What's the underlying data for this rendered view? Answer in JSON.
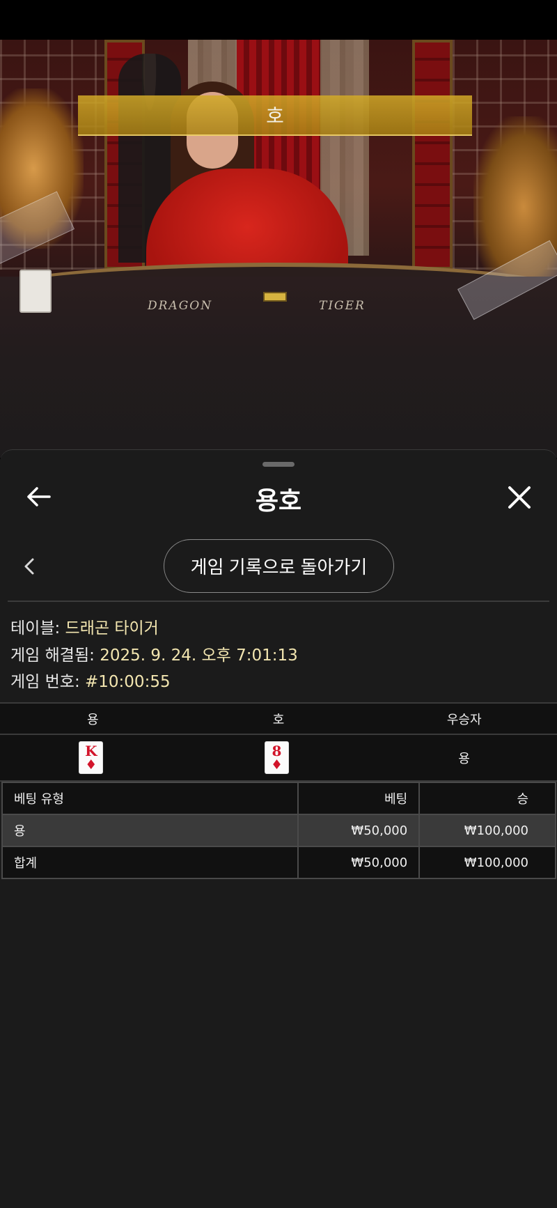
{
  "video": {
    "result_banner": "호",
    "table_labels": {
      "dragon": "DRAGON",
      "tiger": "TIGER"
    }
  },
  "sheet": {
    "title": "용호",
    "back_icon": "arrow-left-icon",
    "close_icon": "close-icon",
    "prev_icon": "chevron-left-icon",
    "return_button": "게임 기록으로 돌아가기"
  },
  "info": {
    "table_label": "테이블:",
    "table_value": "드래곤 타이거",
    "resolved_label": "게임 해결됨:",
    "resolved_value": "2025. 9. 24. 오후 7:01:13",
    "game_no_label": "게임 번호:",
    "game_no_value": "#10:00:55"
  },
  "cards": {
    "headers": [
      "용",
      "호",
      "우승자"
    ],
    "dragon_card": {
      "rank": "K",
      "suit": "♦"
    },
    "tiger_card": {
      "rank": "8",
      "suit": "♦"
    },
    "winner": "용",
    "card_color": "#d2142a"
  },
  "bets": {
    "headers": [
      "베팅 유형",
      "베팅",
      "승"
    ],
    "rows": [
      {
        "type": "용",
        "bet": "₩50,000",
        "win": "₩100,000"
      },
      {
        "type": "합계",
        "bet": "₩50,000",
        "win": "₩100,000"
      }
    ]
  },
  "colors": {
    "accent_value": "#f3e6b0",
    "sheet_bg": "#1b1b1b",
    "banner_gold": "#c9a22a"
  }
}
